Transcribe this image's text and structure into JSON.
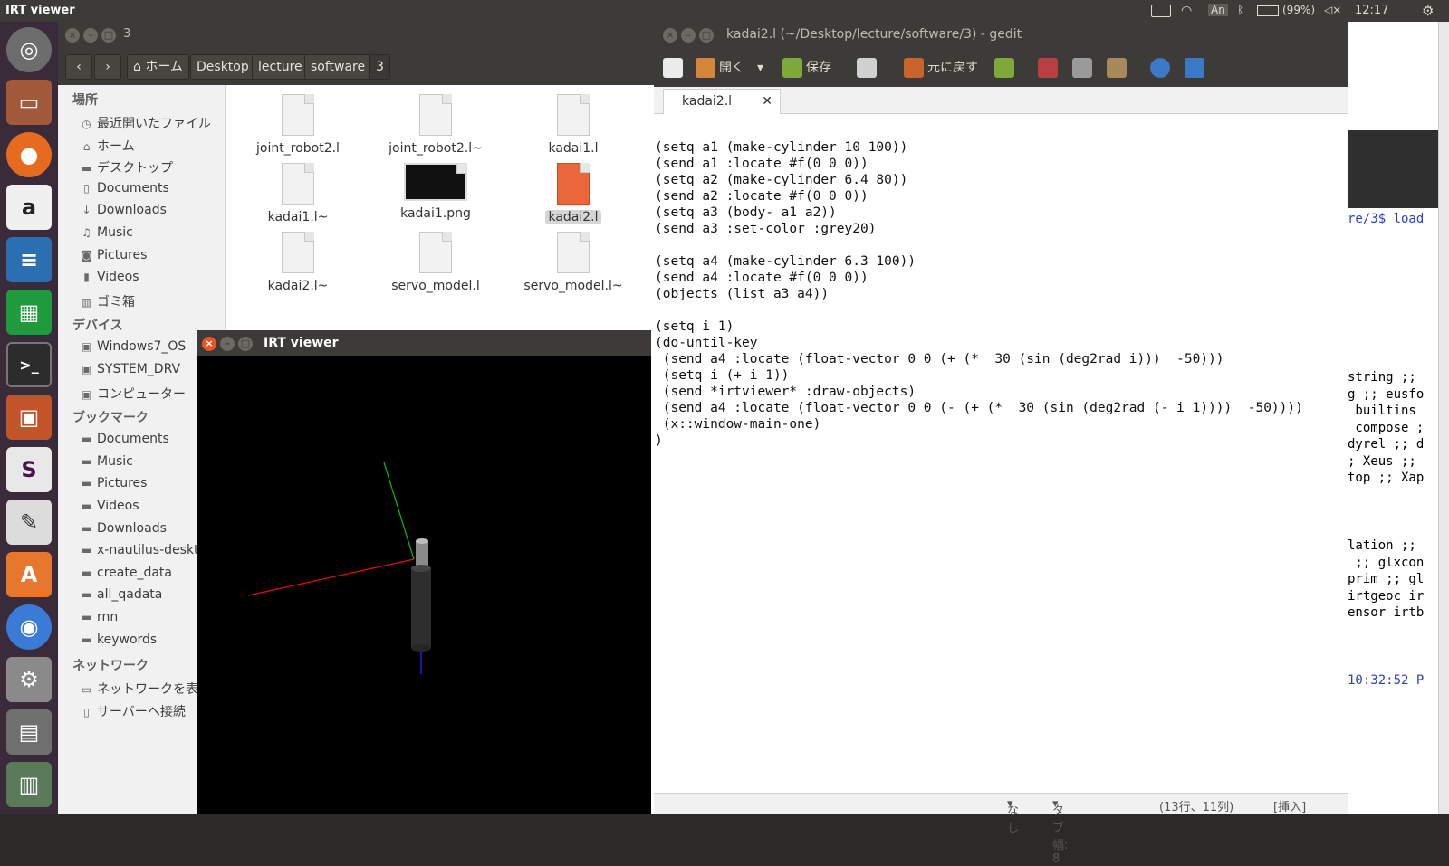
{
  "top_panel": {
    "app_title": "IRT viewer",
    "keyboard_indicator": "An",
    "battery": "(99%)",
    "clock": "12:17"
  },
  "launcher": {
    "items": [
      "ubuntu-logo-icon",
      "files-icon",
      "firefox-icon",
      "amazon-icon",
      "writer-icon",
      "calc-icon",
      "terminal-icon",
      "impress-icon",
      "slack-icon",
      "text-editor-icon",
      "software-center-icon",
      "chromium-icon",
      "settings-icon",
      "workspace-icon",
      "trash-icon"
    ]
  },
  "nautilus": {
    "title": "3",
    "path": [
      "ホーム",
      "Desktop",
      "lecture",
      "software",
      "3"
    ],
    "sidebar": {
      "places_header": "場所",
      "places": [
        {
          "icon": "clock-icon",
          "label": "最近開いたファイル"
        },
        {
          "icon": "home-icon",
          "label": "ホーム"
        },
        {
          "icon": "folder-icon",
          "label": "デスクトップ"
        },
        {
          "icon": "document-icon",
          "label": "Documents"
        },
        {
          "icon": "download-icon",
          "label": "Downloads"
        },
        {
          "icon": "music-icon",
          "label": "Music"
        },
        {
          "icon": "camera-icon",
          "label": "Pictures"
        },
        {
          "icon": "video-icon",
          "label": "Videos"
        },
        {
          "icon": "trash-icon",
          "label": "ゴミ箱"
        }
      ],
      "devices_header": "デバイス",
      "devices": [
        {
          "icon": "drive-icon",
          "label": "Windows7_OS"
        },
        {
          "icon": "drive-icon",
          "label": "SYSTEM_DRV"
        },
        {
          "icon": "drive-icon",
          "label": "コンピューター"
        }
      ],
      "bookmarks_header": "ブックマーク",
      "bookmarks": [
        {
          "icon": "folder-icon",
          "label": "Documents"
        },
        {
          "icon": "folder-icon",
          "label": "Music"
        },
        {
          "icon": "folder-icon",
          "label": "Pictures"
        },
        {
          "icon": "folder-icon",
          "label": "Videos"
        },
        {
          "icon": "folder-icon",
          "label": "Downloads"
        },
        {
          "icon": "folder-icon",
          "label": "x-nautilus-deskt"
        },
        {
          "icon": "folder-icon",
          "label": "create_data"
        },
        {
          "icon": "folder-icon",
          "label": "all_qadata"
        },
        {
          "icon": "folder-icon",
          "label": "rnn"
        },
        {
          "icon": "folder-icon",
          "label": "keywords"
        }
      ],
      "network_header": "ネットワーク",
      "network": [
        {
          "icon": "network-icon",
          "label": "ネットワークを表示"
        },
        {
          "icon": "server-icon",
          "label": "サーバーへ接続"
        }
      ]
    },
    "files": [
      {
        "name": "joint_robot2.l",
        "type": "lisp",
        "selected": false
      },
      {
        "name": "joint_robot2.l~",
        "type": "text",
        "selected": false
      },
      {
        "name": "kadai1.l",
        "type": "lisp",
        "selected": false
      },
      {
        "name": "kadai1.l~",
        "type": "text",
        "selected": false
      },
      {
        "name": "kadai1.png",
        "type": "image",
        "selected": false
      },
      {
        "name": "kadai2.l",
        "type": "lisp",
        "selected": true
      },
      {
        "name": "kadai2.l~",
        "type": "text",
        "selected": false
      },
      {
        "name": "servo_model.l",
        "type": "lisp",
        "selected": false
      },
      {
        "name": "servo_model.l~",
        "type": "text",
        "selected": false
      }
    ]
  },
  "gedit": {
    "title": "kadai2.l (~/Desktop/lecture/software/3) - gedit",
    "toolbar": {
      "open": "開く",
      "save": "保存",
      "undo": "元に戻す"
    },
    "tab_label": "kadai2.l",
    "code_lines": [
      "",
      "(setq a1 (make-cylinder 10 100))",
      "(send a1 :locate #f(0 0 0))",
      "(setq a2 (make-cylinder 6.4 80))",
      "(send a2 :locate #f(0 0 0))",
      "(setq a3 (body- a1 a2))",
      "(send a3 :set-color :grey20)",
      "",
      "(setq a4 (make-cylinder 6.3 100))",
      "(send a4 :locate #f(0 0 0))",
      "(objects (list a3 a4))",
      "",
      "(setq i 1)",
      "(do-until-key",
      " (send a4 :locate (float-vector 0 0 (+ (*  30 (sin (deg2rad i)))  -50)))",
      " (setq i (+ i 1))",
      " (send *irtviewer* :draw-objects)",
      " (send a4 :locate (float-vector 0 0 (- (+ (*  30 (sin (deg2rad (- i 1))))  -50))))",
      " (x::window-main-one)",
      ")"
    ],
    "status": {
      "lang": "なし",
      "tab_width": "タブ幅: 8",
      "position": "(13行、11列)",
      "mode": "[挿入]"
    }
  },
  "irt_viewer": {
    "title": "IRT viewer"
  },
  "terminal": {
    "lines": [
      {
        "row": 0,
        "text": "re/3$ load"
      },
      {
        "row": 1,
        "text": ""
      },
      {
        "row": 2,
        "text": "string ;; "
      },
      {
        "row": 3,
        "text": "g ;; eusfo"
      },
      {
        "row": 4,
        "text": " builtins "
      },
      {
        "row": 5,
        "text": " compose ;"
      },
      {
        "row": 6,
        "text": "dyrel ;; d"
      },
      {
        "row": 7,
        "text": "; Xeus ;; "
      },
      {
        "row": 8,
        "text": "top ;; Xap"
      },
      {
        "row": 9,
        "text": "lation ;; "
      },
      {
        "row": 10,
        "text": " ;; glxcon"
      },
      {
        "row": 11,
        "text": "prim ;; gl"
      },
      {
        "row": 12,
        "text": "irtgeoc ir"
      },
      {
        "row": 13,
        "text": "ensor irtb"
      },
      {
        "row": 14,
        "text": "10:32:52 P"
      }
    ]
  }
}
